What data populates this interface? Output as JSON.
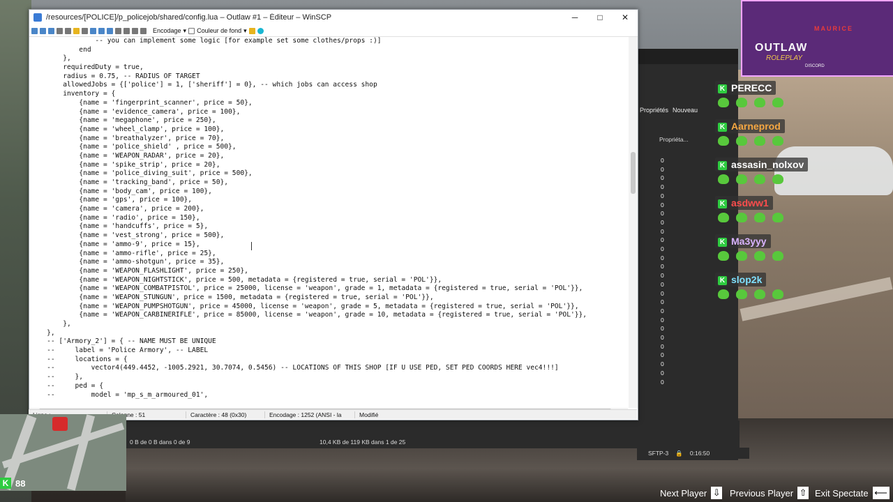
{
  "editor_window": {
    "title": "/resources/[POLICE]/p_policejob/shared/config.lua – Outlaw #1 – Éditeur – WinSCP",
    "controls": {
      "minimize": "─",
      "maximize": "□",
      "close": "✕"
    },
    "toolbar": {
      "encoding_label": "Encodage",
      "background_color_label": "Couleur de fond"
    },
    "code_lines": [
      "                -- you can implement some logic [for example set some clothes/props :)]",
      "            end",
      "        },",
      "        requiredDuty = true,",
      "        radius = 0.75, -- RADIUS OF TARGET",
      "        allowedJobs = {['police'] = 1, ['sheriff'] = 0}, -- which jobs can access shop",
      "        inventory = {",
      "            {name = 'fingerprint_scanner', price = 50},",
      "            {name = 'evidence_camera', price = 100},",
      "            {name = 'megaphone', price = 250},",
      "            {name = 'wheel_clamp', price = 100},",
      "            {name = 'breathalyzer', price = 70},",
      "            {name = 'police_shield' , price = 500},",
      "            {name = 'WEAPON_RADAR', price = 20},",
      "            {name = 'spike_strip', price = 20},",
      "            {name = 'police_diving_suit', price = 500},",
      "            {name = 'tracking_band', price = 50},",
      "            {name = 'body_cam', price = 100},",
      "            {name = 'gps', price = 100},",
      "            {name = 'camera', price = 200},",
      "            {name = 'radio', price = 150},",
      "            {name = 'handcuffs', price = 5},",
      "            {name = 'vest_strong', price = 500},",
      "            {name = 'ammo-9', price = 15},",
      "            {name = 'ammo-rifle', price = 25},",
      "            {name = 'ammo-shotgun', price = 35},",
      "            {name = 'WEAPON_FLASHLIGHT', price = 250},",
      "            {name = 'WEAPON_NIGHTSTICK', price = 500, metadata = {registered = true, serial = 'POL'}},",
      "            {name = 'WEAPON_COMBATPISTOL', price = 25000, license = 'weapon', grade = 1, metadata = {registered = true, serial = 'POL'}},",
      "            {name = 'WEAPON_STUNGUN', price = 1500, metadata = {registered = true, serial = 'POL'}},",
      "            {name = 'WEAPON_PUMPSHOTGUN', price = 45000, license = 'weapon', grade = 5, metadata = {registered = true, serial = 'POL'}},",
      "            {name = 'WEAPON_CARBINERIFLE', price = 85000, license = 'weapon', grade = 10, metadata = {registered = true, serial = 'POL'}},",
      "        },",
      "    },",
      "    -- ['Armory_2'] = { -- NAME MUST BE UNIQUE",
      "    --     label = 'Police Armory', -- LABEL",
      "    --     locations = {",
      "    --         vector4(449.4452, -1005.2921, 30.7074, 0.5456) -- LOCATIONS OF THIS SHOP [IF U USE PED, SET PED COORDS HERE vec4!!!]",
      "    --     },",
      "    --     ped = {",
      "    --         model = 'mp_s_m_armoured_01',"
    ],
    "statusbar": {
      "line": "Ligne :",
      "column": "Colonne : 51",
      "character": "Caractère : 48 (0x30)",
      "encoding": "Encodage : 1252  (ANSI - la",
      "modified": "Modifié"
    }
  },
  "main_winscp": {
    "toolbar": {
      "properties": "Propriétés",
      "new": "Nouveau"
    },
    "column_header": "Propriéta...",
    "zero_values": [
      "0",
      "0",
      "0",
      "0",
      "0",
      "0",
      "0",
      "0",
      "0",
      "0",
      "0",
      "0",
      "0",
      "0",
      "0",
      "0",
      "0",
      "0",
      "0",
      "0",
      "0",
      "0",
      "0",
      "0",
      "0",
      "0"
    ],
    "local_status": "0 B de 0 B dans 0 de 9",
    "remote_status": "10,4 KB de 119 KB dans 1 de 25",
    "protocol": "SFTP-3",
    "time": "0:16:50"
  },
  "players": [
    {
      "name": "PERECC",
      "color": "#ffffff"
    },
    {
      "name": "Aarneprod",
      "color": "#f5a742"
    },
    {
      "name": "assasin_nolxov",
      "color": "#ffffff"
    },
    {
      "name": "asdww1",
      "color": "#ff4d4d"
    },
    {
      "name": "Ma3yyy",
      "color": "#d9b3ff"
    },
    {
      "name": "slop2k",
      "color": "#7fe0ff"
    }
  ],
  "logo": {
    "line1": "OUTLAW",
    "line2": "ROLEPLAY",
    "line3": "MAURICE",
    "line4": "DISCORD"
  },
  "hud": {
    "health": "88",
    "k_label": "K"
  },
  "spectate": {
    "next": "Next Player",
    "previous": "Previous Player",
    "exit": "Exit Spectate"
  }
}
